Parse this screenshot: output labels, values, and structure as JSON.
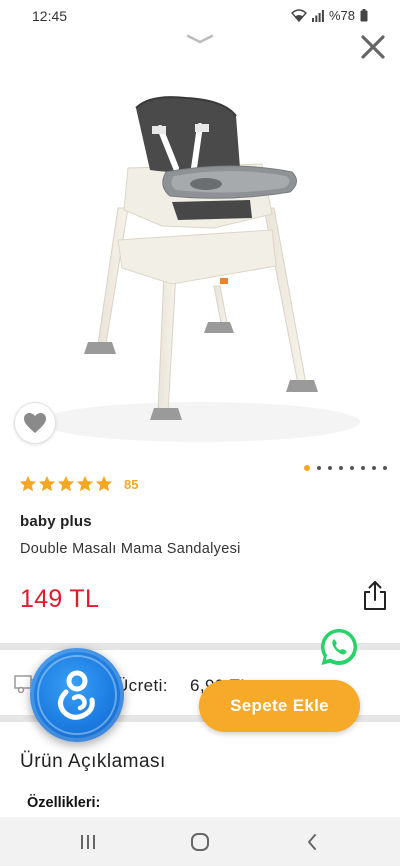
{
  "status_bar": {
    "time": "12:45",
    "battery": "%78"
  },
  "product": {
    "rating_count": "85",
    "rating_stars": 5,
    "brand": "baby plus",
    "title": "Double Masalı Mama Sandalyesi",
    "price": "149 TL",
    "image_count": 8,
    "active_image_index": 0
  },
  "shipping": {
    "label": "Ücreti:",
    "value": "6,99 TL"
  },
  "actions": {
    "add_to_cart": "Sepete Ekle"
  },
  "description": {
    "title": "Ürün Açıklaması",
    "features_label": "Özellikleri:"
  },
  "colors": {
    "accent": "#f7a929",
    "price": "#e0192b",
    "whatsapp": "#25d366",
    "assistant": "#1b7be0"
  },
  "icons": [
    "wifi-icon",
    "signal-icon",
    "battery-icon",
    "chevron-down-icon",
    "close-icon",
    "heart-icon",
    "star-icon",
    "share-icon",
    "truck-icon",
    "whatsapp-icon",
    "assistant-icon",
    "recent-apps-icon",
    "home-icon",
    "back-icon"
  ]
}
